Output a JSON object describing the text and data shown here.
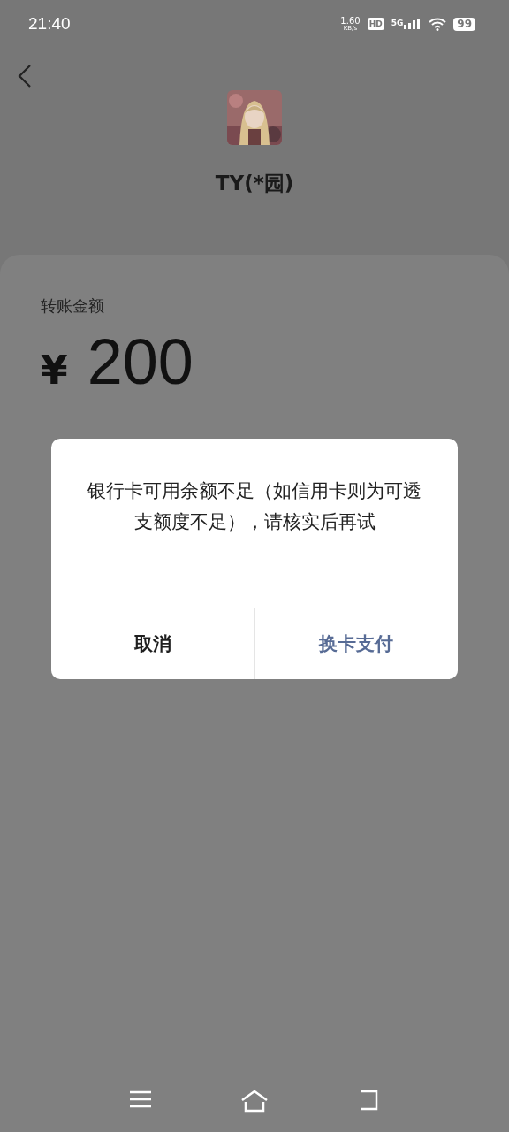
{
  "status_bar": {
    "time": "21:40",
    "speed": "1.60",
    "speed_unit": "KB/s",
    "hd": "HD",
    "network": "5G",
    "battery": "99"
  },
  "payee": {
    "name": "TY(*园)"
  },
  "transfer": {
    "label": "转账金额",
    "currency": "¥",
    "amount": "200"
  },
  "dialog": {
    "message": "银行卡可用余额不足（如信用卡则为可透支额度不足），请核实后再试",
    "buttons": [
      {
        "label": "取消",
        "kind": "cancel"
      },
      {
        "label": "换卡支付",
        "kind": "primary"
      }
    ]
  }
}
